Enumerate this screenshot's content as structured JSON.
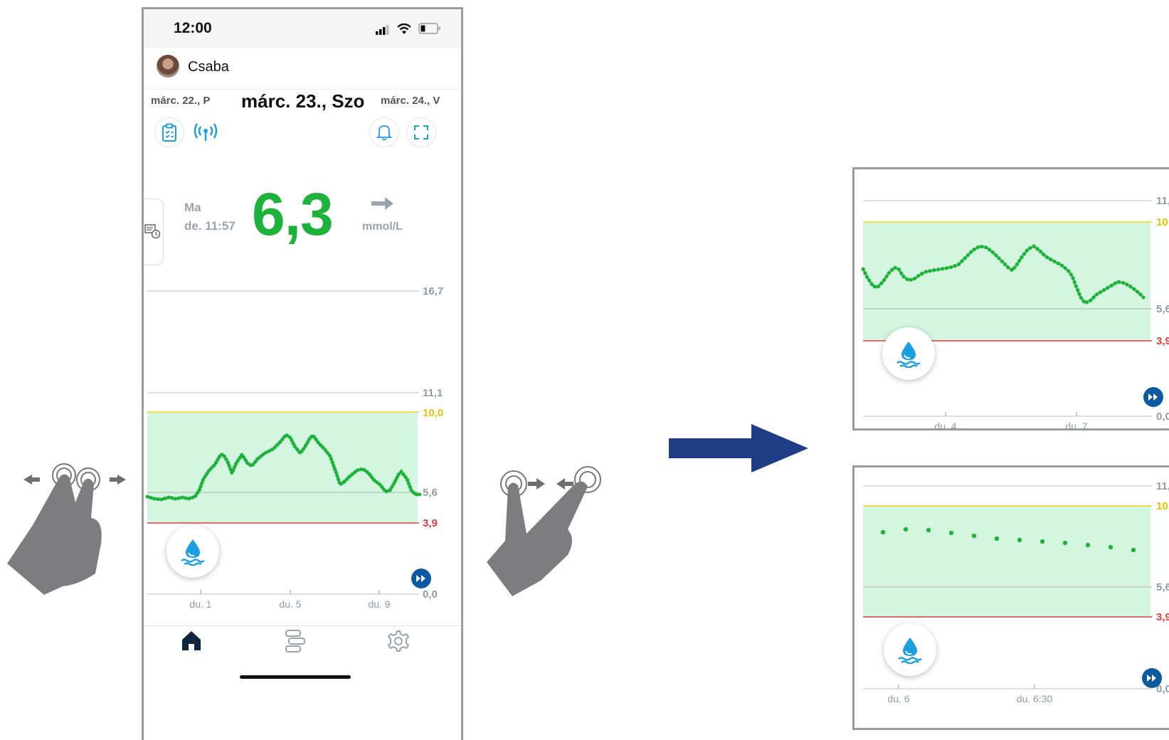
{
  "status": {
    "time": "12:00"
  },
  "user": {
    "name": "Csaba"
  },
  "dates": {
    "prev": "márc. 22., P",
    "current": "márc. 23., Szo",
    "next": "márc. 24., V"
  },
  "reading": {
    "day": "Ma",
    "time": "de. 11:57",
    "value": "6,3",
    "unit": "mmol/L",
    "trend": "arrow-right-icon"
  },
  "colors": {
    "accent_green": "#1db33a",
    "range_fill": "#d4f5e0",
    "high_line": "#f2d21b",
    "low_line": "#e23b3b",
    "brand_blue": "#1a9fe0",
    "navy": "#0d5aa0",
    "big_arrow": "#1f3d85"
  },
  "main_chart": {
    "y_labels": {
      "max": "16,7",
      "top": "11,1",
      "high": "10,0",
      "mid": "5,6",
      "low": "3,9",
      "zero": "0,0"
    },
    "x_labels": [
      "du. 1",
      "du. 5",
      "du. 9"
    ]
  },
  "mini_chart_1": {
    "y_labels": {
      "top": "11,",
      "high": "10",
      "mid": "5,6",
      "low": "3,9",
      "zero": "0,0"
    },
    "x_labels": [
      "du. 4",
      "du. 7"
    ]
  },
  "mini_chart_2": {
    "y_labels": {
      "top": "11,",
      "high": "10,",
      "mid": "5,6",
      "low": "3,9",
      "zero": "0,0"
    },
    "x_labels": [
      "du. 6",
      "du. 6:30"
    ]
  },
  "gestures": {
    "left": "swipe-two-finger-icon",
    "right": "pinch-icon",
    "transition": "arrow-right-icon"
  },
  "tabs": [
    {
      "icon": "home-icon"
    },
    {
      "icon": "log-icon"
    },
    {
      "icon": "settings-icon"
    }
  ]
}
